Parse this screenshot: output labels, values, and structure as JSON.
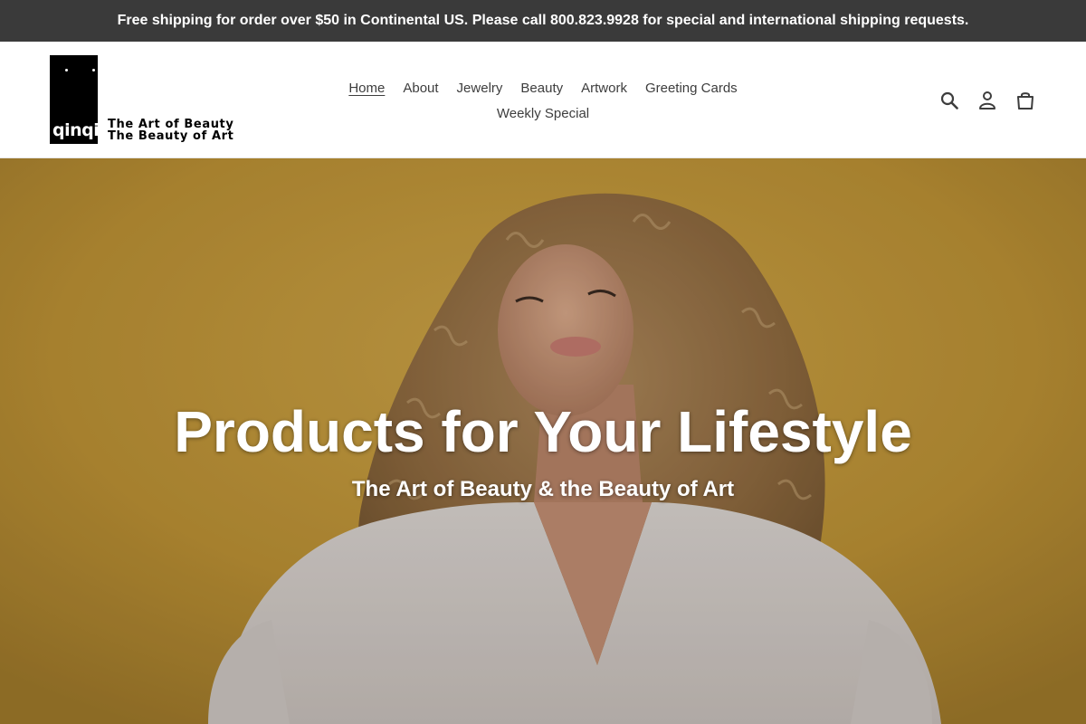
{
  "announcement": {
    "text": "Free shipping for order over $50 in Continental US. Please call 800.823.9928 for special and international shipping requests."
  },
  "logo": {
    "mark_text": "qinqi",
    "tagline_line1": "The Art of Beauty",
    "tagline_line2": "The Beauty of Art"
  },
  "nav": {
    "items": [
      {
        "label": "Home",
        "active": true
      },
      {
        "label": "About"
      },
      {
        "label": "Jewelry"
      },
      {
        "label": "Beauty"
      },
      {
        "label": "Artwork"
      },
      {
        "label": "Greeting Cards"
      },
      {
        "label": "Weekly Special"
      }
    ]
  },
  "header_icons": [
    "search-icon",
    "account-icon",
    "cart-icon"
  ],
  "hero": {
    "title": "Products for Your Lifestyle",
    "subtitle": "The Art of Beauty & the Beauty of Art",
    "image": "woman with curly hair on mustard-yellow background"
  },
  "colors": {
    "announcement_bg": "#3a3a3a",
    "hero_bg": "#c49a3c",
    "nav_text": "#3d3d3d"
  }
}
